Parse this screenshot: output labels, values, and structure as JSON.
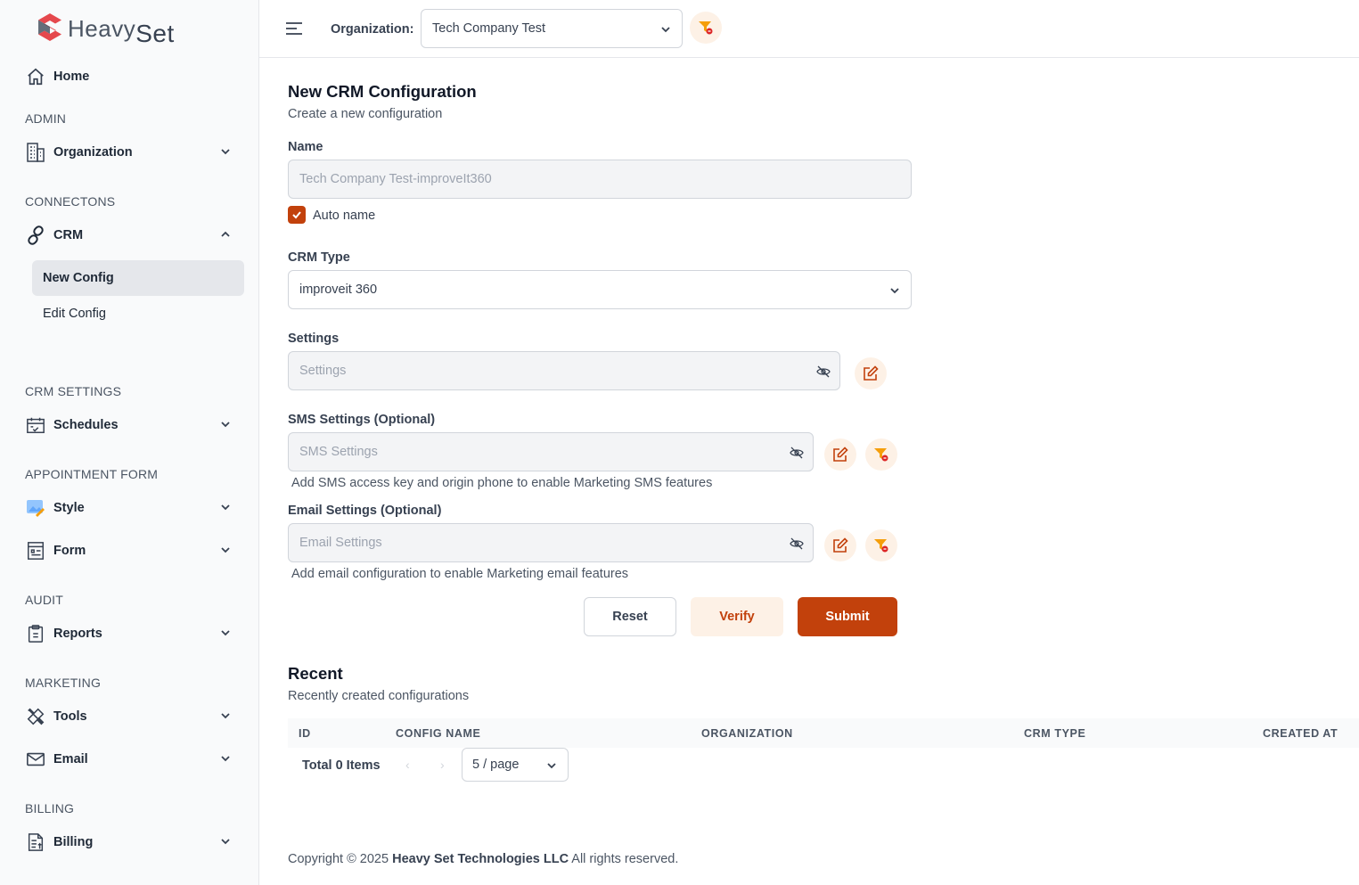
{
  "brand": {
    "name_part1": "Heavy",
    "name_part2": "Set"
  },
  "sidebar": {
    "home": "Home",
    "sections": {
      "admin": "ADMIN",
      "connections": "CONNECTONS",
      "crm_settings": "CRM SETTINGS",
      "appointment_form": "APPOINTMENT FORM",
      "audit": "AUDIT",
      "marketing": "MARKETING",
      "billing": "BILLING"
    },
    "items": {
      "organization": "Organization",
      "crm": "CRM",
      "new_config": "New Config",
      "edit_config": "Edit Config",
      "schedules": "Schedules",
      "style": "Style",
      "form": "Form",
      "reports": "Reports",
      "tools": "Tools",
      "email": "Email",
      "billing": "Billing"
    }
  },
  "header": {
    "org_label": "Organization:",
    "org_value": "Tech Company Test"
  },
  "form": {
    "title": "New CRM Configuration",
    "subtitle": "Create a new configuration",
    "name_label": "Name",
    "name_value": "Tech Company Test-improveIt360",
    "auto_name_label": "Auto name",
    "auto_name_checked": true,
    "crm_type_label": "CRM Type",
    "crm_type_value": "improveit 360",
    "settings_label": "Settings",
    "settings_placeholder": "Settings",
    "sms_label": "SMS Settings (Optional)",
    "sms_placeholder": "SMS Settings",
    "sms_hint": "Add SMS access key and origin phone to enable Marketing SMS features",
    "email_label": "Email Settings (Optional)",
    "email_placeholder": "Email Settings",
    "email_hint": "Add email configuration to enable Marketing email features",
    "reset": "Reset",
    "verify": "Verify",
    "submit": "Submit"
  },
  "recent": {
    "title": "Recent",
    "subtitle": "Recently created configurations",
    "columns": [
      "ID",
      "CONFIG NAME",
      "ORGANIZATION",
      "CRM TYPE",
      "CREATED AT"
    ],
    "total": "Total 0 Items",
    "page_size": "5 / page"
  },
  "footer": {
    "prefix": "Copyright © 2025",
    "company": "Heavy Set Technologies LLC",
    "suffix": "All rights reserved."
  },
  "colors": {
    "accent": "#c2410c",
    "accent_soft": "#fdf1e6"
  }
}
